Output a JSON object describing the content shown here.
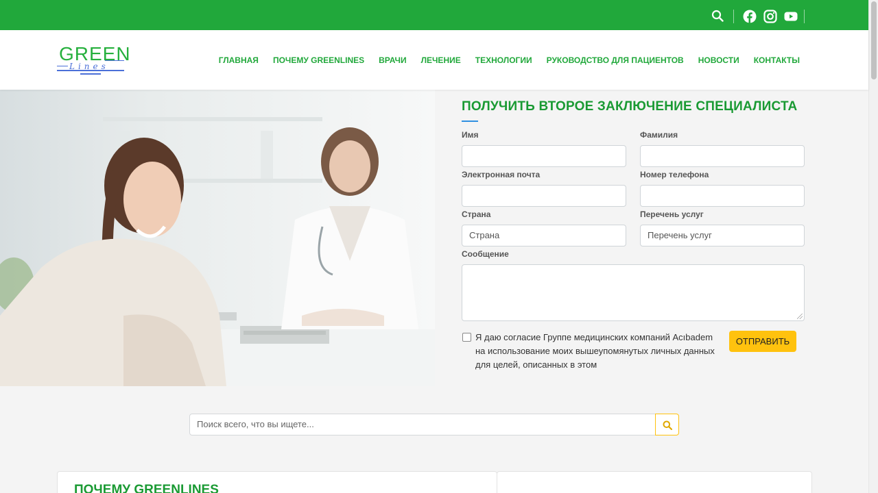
{
  "topbar": {
    "background": "#21a83b",
    "icons": [
      "search-icon",
      "facebook-icon",
      "instagram-icon",
      "youtube-icon"
    ]
  },
  "header": {
    "logo": {
      "word": "GREEN",
      "script": "Lines"
    },
    "nav": [
      "ГЛАВНАЯ",
      "ПОЧЕМУ GREENLINES",
      "ВРАЧИ",
      "ЛЕЧЕНИЕ",
      "ТЕХНОЛОГИИ",
      "РУКОВОДСТВО ДЛЯ ПАЦИЕНТОВ",
      "НОВОСТИ",
      "КОНТАКТЫ"
    ]
  },
  "form": {
    "title": "ПОЛУЧИТЬ ВТОРОЕ ЗАКЛЮЧЕНИЕ СПЕЦИАЛИСТА",
    "first_name_label": "Имя",
    "last_name_label": "Фамилия",
    "email_label": "Электронная почта",
    "phone_label": "Номер телефона",
    "country_label": "Страна",
    "country_value": "Страна",
    "services_label": "Перечень услуг",
    "services_value": "Перечень услуг",
    "message_label": "Сообщение",
    "consent_text": "Я даю согласие Группе медицинских компаний Acıbadem на использование моих вышеупомянутых личных данных для целей, описанных в этом",
    "submit_label": "ОТПРАВИТЬ"
  },
  "search": {
    "placeholder": "Поиск всего, что вы ищете..."
  },
  "sections": {
    "why_title": "ПОЧЕМУ GREENLINES"
  },
  "colors": {
    "brand_green": "#21a83b",
    "title_green": "#1a9a33",
    "accent_yellow": "#ffc20e"
  }
}
